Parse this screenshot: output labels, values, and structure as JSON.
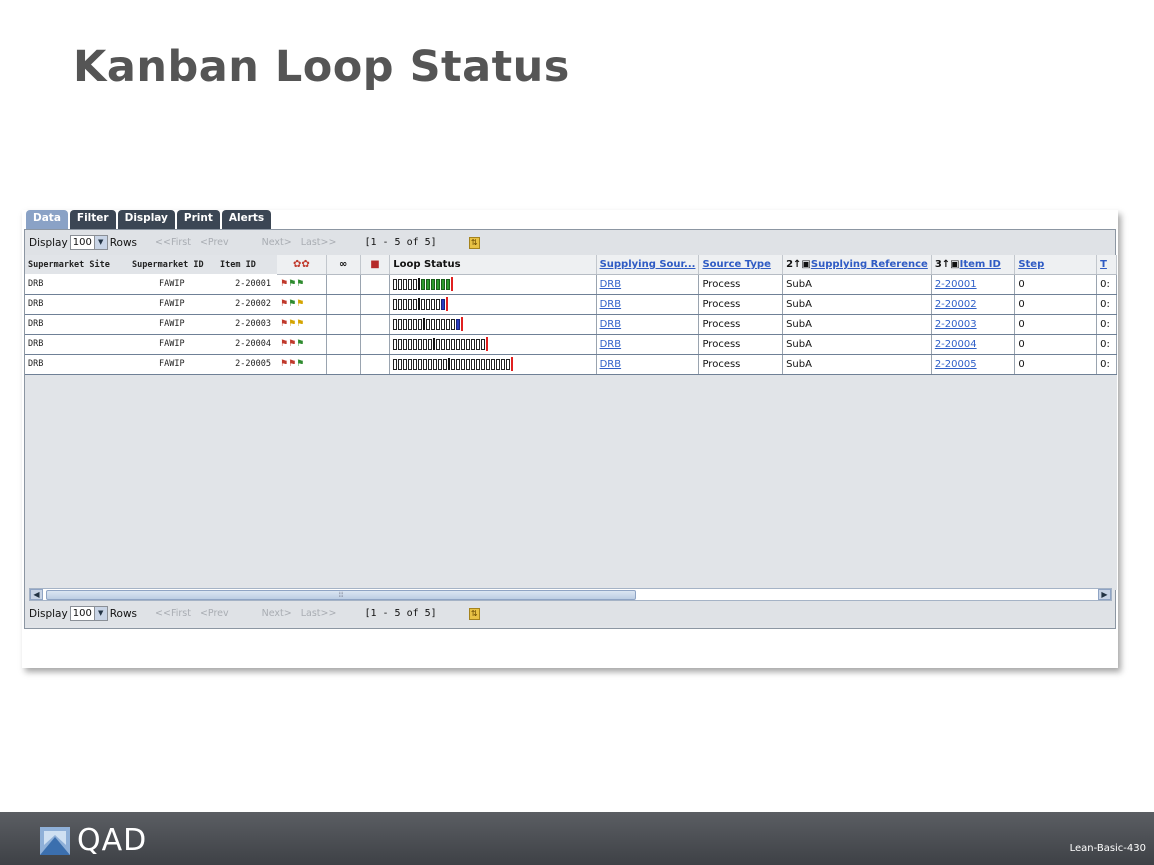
{
  "slide": {
    "title": "Kanban Loop Status",
    "code": "Lean-Basic-430",
    "logo_text": "QAD"
  },
  "tabs": [
    {
      "label": "Data"
    },
    {
      "label": "Filter"
    },
    {
      "label": "Display"
    },
    {
      "label": "Print"
    },
    {
      "label": "Alerts"
    }
  ],
  "pager": {
    "display_label": "Display",
    "rows_value": "100",
    "rows_label": "Rows",
    "first": "<<First",
    "prev": "<Prev",
    "next": "Next>",
    "last": "Last>>",
    "count": "[1 - 5  of  5]"
  },
  "columns": {
    "site": "Supermarket Site",
    "sm_id": "Supermarket ID",
    "item": "Item ID",
    "loop_status": "Loop Status",
    "supplying_source": "Supplying Sour...",
    "source_type": "Source Type",
    "supplying_reference_sort": "2↑▣",
    "supplying_reference": "Supplying Reference",
    "item_id_sort": "3↑▣",
    "item_id": "Item ID",
    "step": "Step",
    "trunc": "T"
  },
  "icons": {
    "alert_col": "kanban-cards-icon",
    "sequence_col": "sequence-icon",
    "supermarket_col": "supermarket-icon"
  },
  "rows": [
    {
      "site": "DRB",
      "sm_id": "FAWIP",
      "item": "2-20001",
      "source": "DRB",
      "type": "Process",
      "ref": "SubA",
      "item_id": "2-20001",
      "step": "0",
      "trunc": "0:",
      "status": "rgg"
    },
    {
      "site": "DRB",
      "sm_id": "FAWIP",
      "item": "2-20002",
      "source": "DRB",
      "type": "Process",
      "ref": "SubA",
      "item_id": "2-20002",
      "step": "0",
      "trunc": "0:",
      "status": "rgy"
    },
    {
      "site": "DRB",
      "sm_id": "FAWIP",
      "item": "2-20003",
      "source": "DRB",
      "type": "Process",
      "ref": "SubA",
      "item_id": "2-20003",
      "step": "0",
      "trunc": "0:",
      "status": "ryy"
    },
    {
      "site": "DRB",
      "sm_id": "FAWIP",
      "item": "2-20004",
      "source": "DRB",
      "type": "Process",
      "ref": "SubA",
      "item_id": "2-20004",
      "step": "0",
      "trunc": "0:",
      "status": "rrg"
    },
    {
      "site": "DRB",
      "sm_id": "FAWIP",
      "item": "2-20005",
      "source": "DRB",
      "type": "Process",
      "ref": "SubA",
      "item_id": "2-20005",
      "step": "0",
      "trunc": "0:",
      "status": "rrg"
    }
  ],
  "loop_bins": [
    {
      "empty": 5,
      "filled": 6,
      "color": "g"
    },
    {
      "empty": 5,
      "after": 4,
      "filled": 1,
      "color": "b"
    },
    {
      "empty": 6,
      "after": 6,
      "filled": 1,
      "color": "b"
    },
    {
      "empty": 8,
      "after": 10,
      "filled": 0,
      "color": ""
    },
    {
      "empty": 11,
      "after": 12,
      "filled": 0,
      "color": ""
    }
  ],
  "colors": {
    "header_tab": "#3b4654",
    "active_tab": "#8aa2c6",
    "link": "#3060c8",
    "footer": "#4a4d52"
  }
}
